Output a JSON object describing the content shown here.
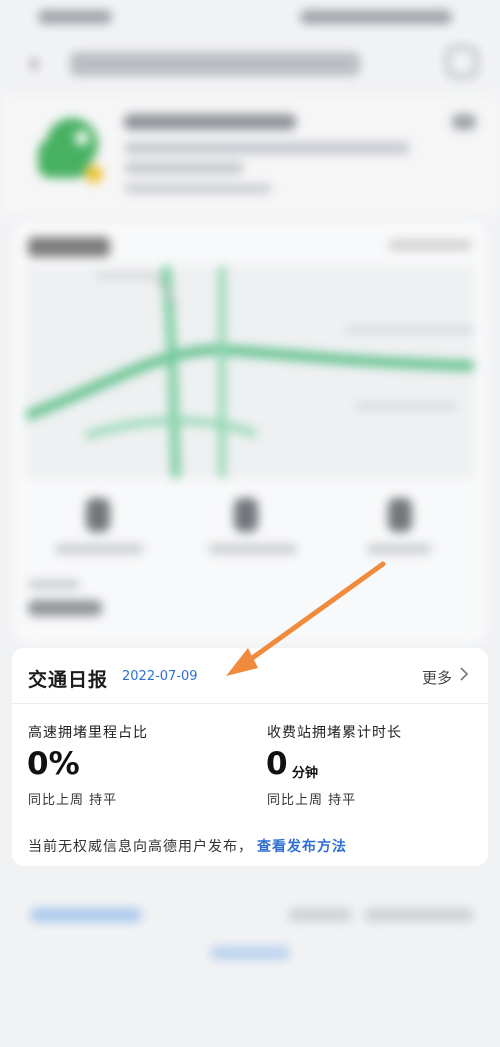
{
  "traffic_card": {
    "title": "交通日报",
    "date": "2022-07-09",
    "more_label": "更多",
    "stats": [
      {
        "label": "高速拥堵里程占比",
        "value": "0%",
        "unit": "",
        "compare": "同比上周 持平"
      },
      {
        "label": "收费站拥堵累计时长",
        "value": "0",
        "unit": "分钟",
        "compare": "同比上周 持平"
      }
    ],
    "note": "当前无权威信息向高德用户发布，",
    "note_link": "查看发布方法"
  },
  "colors": {
    "accent_blue": "#2f6fd4",
    "arrow_orange": "#f08a3c",
    "map_green": "#5cc08a",
    "logo_green": "#3fae5a"
  },
  "icons": {
    "back": "chevron-left",
    "card_more": "chevron-right",
    "arrow": "orange-pointer-arrow"
  }
}
